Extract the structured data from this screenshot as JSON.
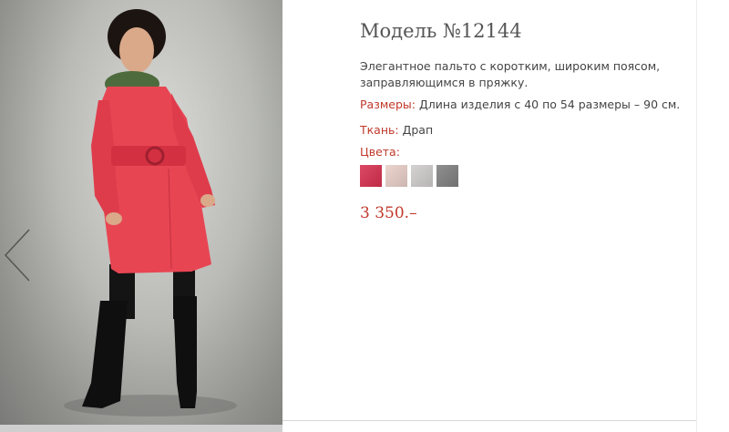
{
  "product": {
    "title": "Модель №12144",
    "description": "Элегантное пальто  с коротким, широким  поясом, заправляющимся в пряжку.",
    "sizes_label": "Размеры:",
    "sizes_value": " Длина изделия с 40 по 54 размеры – 90 см.",
    "fabric_label": "Ткань:",
    "fabric_value": " Драп",
    "colors_label": "Цвета:",
    "price": "3 350.–"
  },
  "colors": [
    "#d8304f",
    "#e9cfc8",
    "#cfcccc",
    "#808080"
  ],
  "photo": {
    "icons": [
      "chevron-left-icon"
    ]
  }
}
